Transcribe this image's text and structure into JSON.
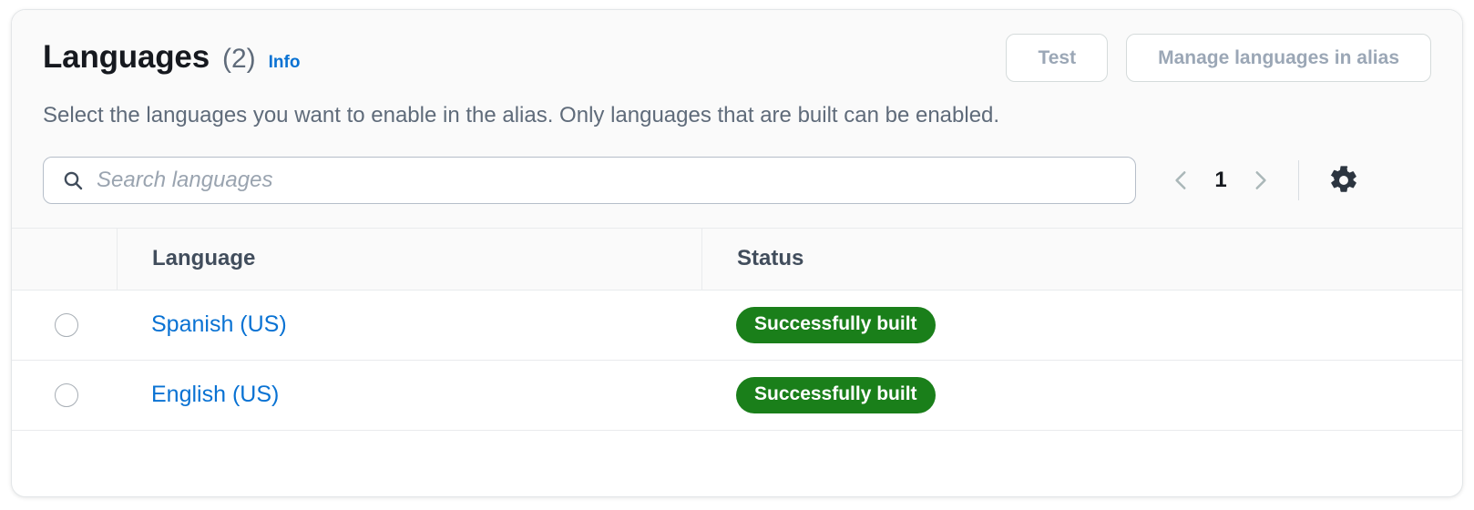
{
  "header": {
    "title": "Languages",
    "counter": "(2)",
    "info_label": "Info",
    "description": "Select the languages you want to enable in the alias. Only languages that are built can be enabled.",
    "actions": {
      "test_label": "Test",
      "manage_label": "Manage languages in alias"
    }
  },
  "toolbar": {
    "search_placeholder": "Search languages",
    "search_value": "",
    "pagination": {
      "current_page": "1",
      "prev_label": "‹",
      "next_label": "›"
    }
  },
  "table": {
    "columns": {
      "language": "Language",
      "status": "Status"
    },
    "rows": [
      {
        "language": "Spanish (US)",
        "status": "Successfully built"
      },
      {
        "language": "English (US)",
        "status": "Successfully built"
      }
    ]
  },
  "colors": {
    "link": "#0972d3",
    "status_success": "#1a7f1a",
    "title": "#16191f",
    "muted": "#5f6b7a",
    "disabled_text": "#9ba7b6"
  }
}
